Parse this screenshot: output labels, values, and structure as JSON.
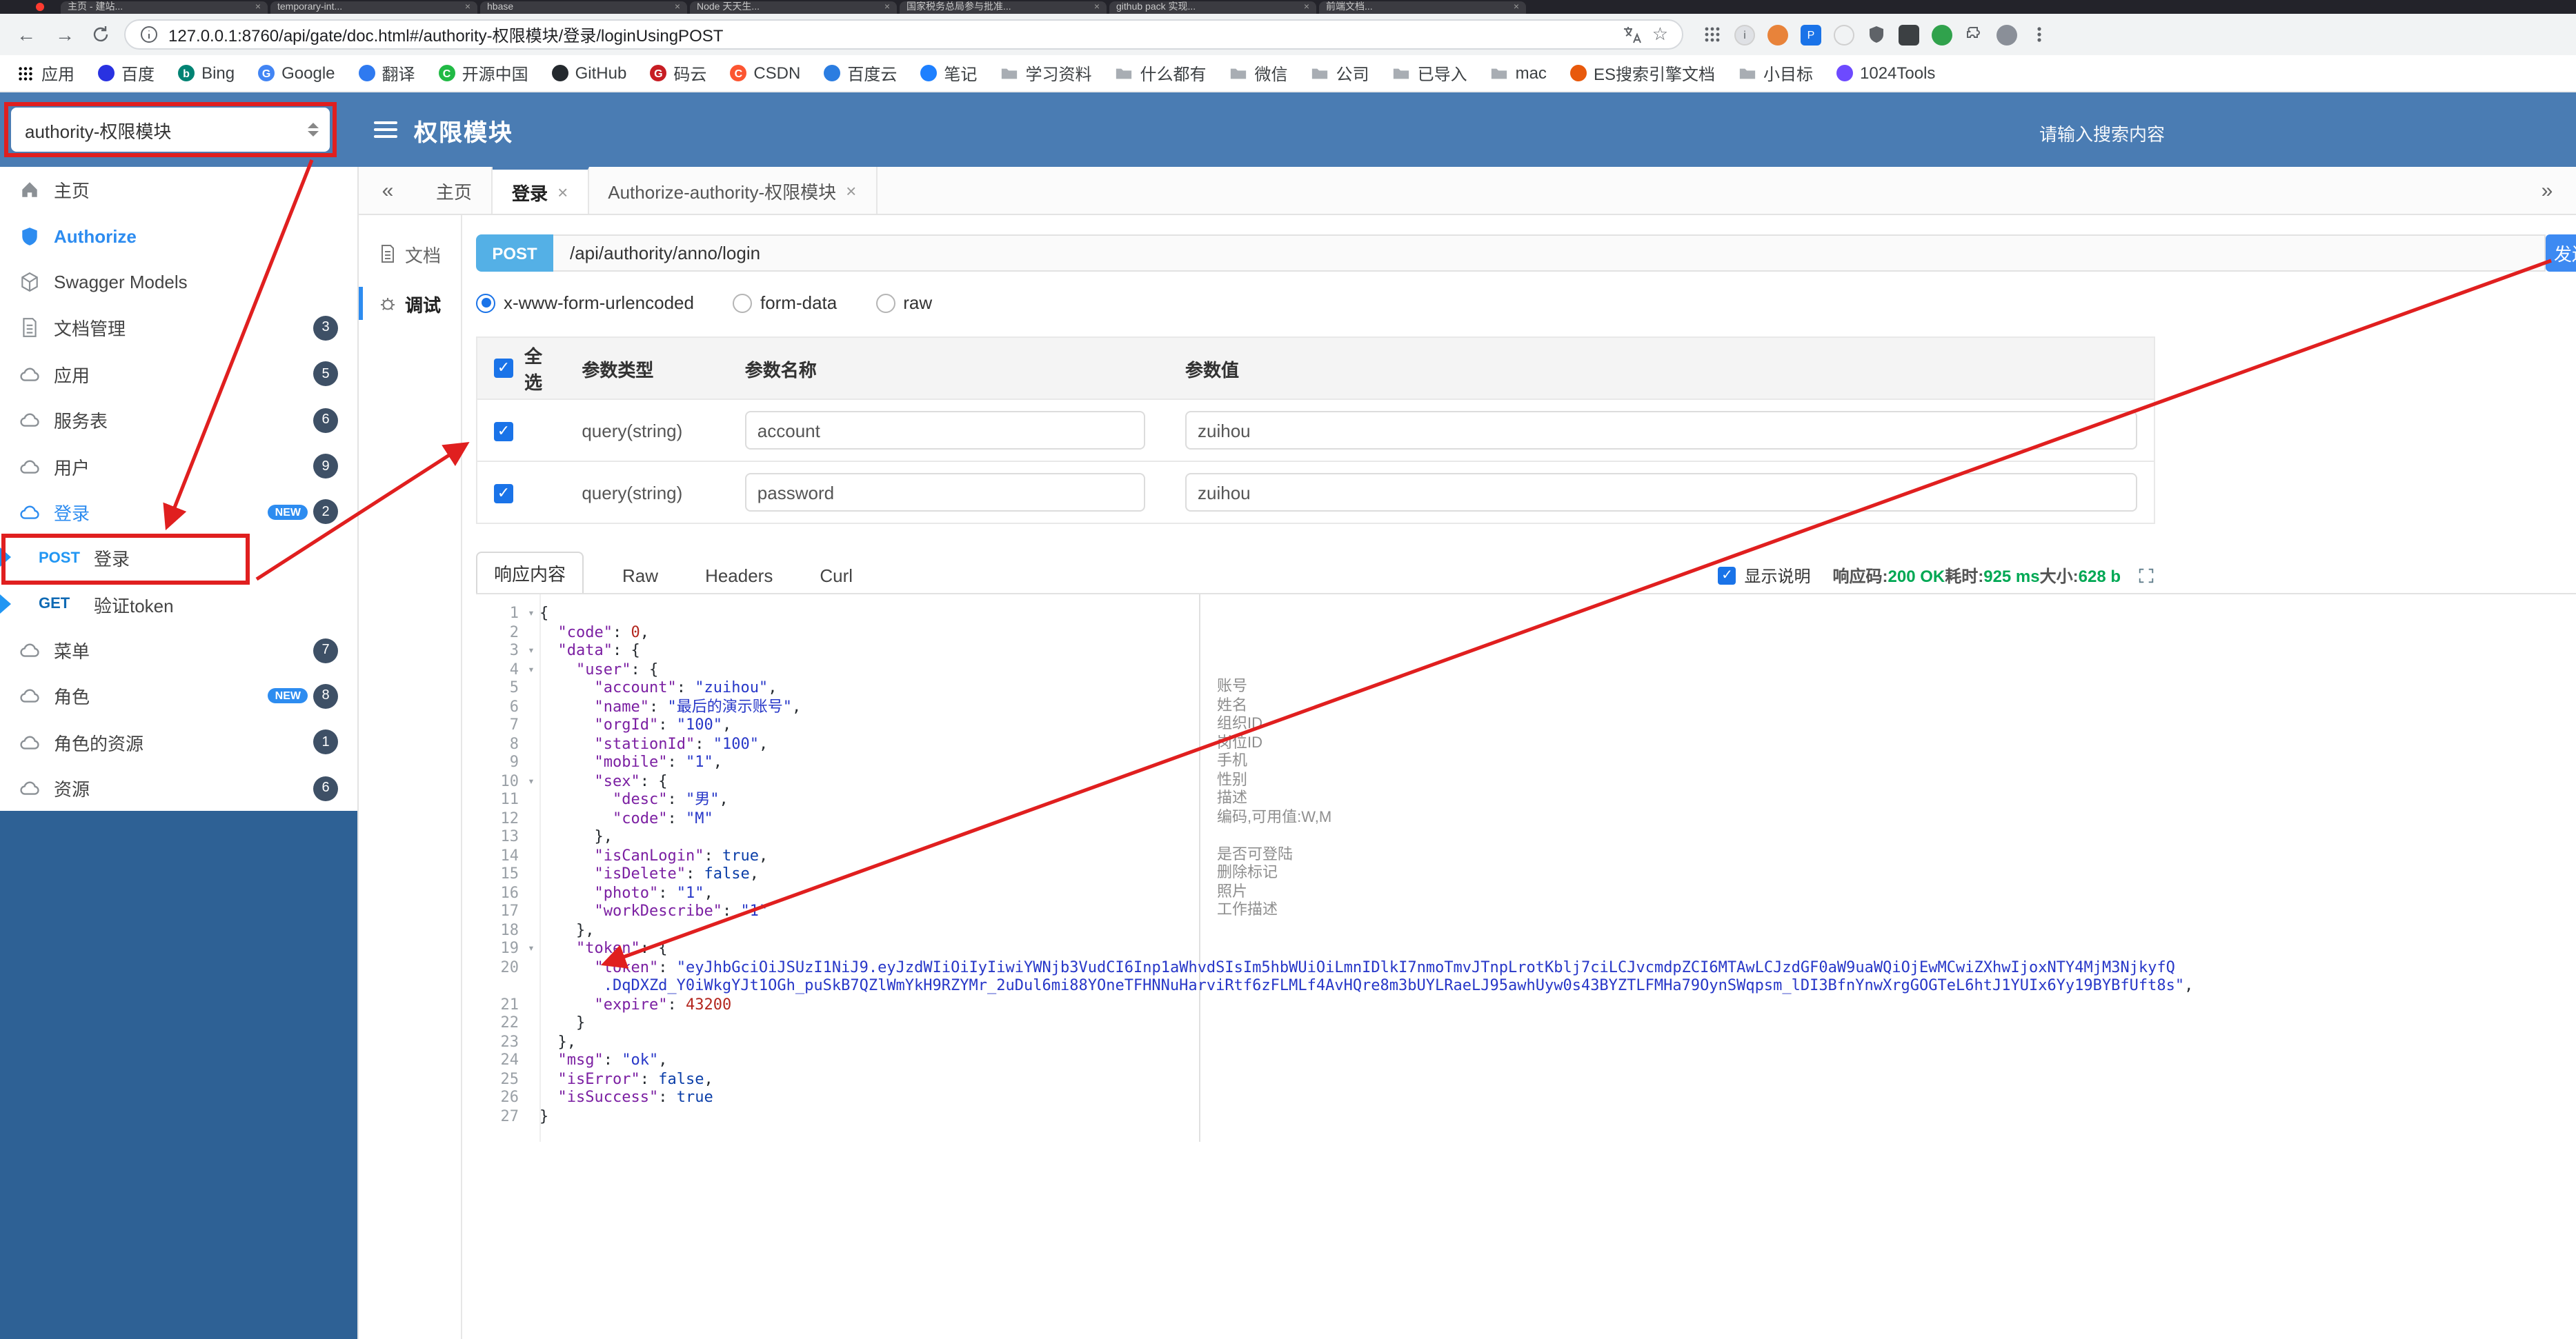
{
  "ui": {
    "back_glyph": "←",
    "forward_glyph": "→",
    "star_glyph": "☆",
    "check_glyph": "✓",
    "fold_glyph": "▾",
    "close_glyph": "×",
    "collapse_glyph": "«",
    "expand_glyph": "»"
  },
  "colors": {
    "header_blue": "#4a7cb3",
    "sidebar_blue": "#2e6195",
    "accent": "#2d8cf0",
    "post": "#2196f3",
    "get": "#0f6ab4",
    "send": "#3d8af2",
    "annotation_red": "#e01f1f",
    "success_green": "#00a854",
    "badge": "#3e5066"
  },
  "browser": {
    "tabs": [
      "主页 - 建站...",
      "temporary-int...",
      "hbase",
      "Node 天天生...",
      "国家税务总局参与批准...",
      "github pack 实现...",
      "前端文档..."
    ],
    "address": {
      "url": "127.0.0.1:8760/api/gate/doc.html#/authority-权限模块/登录/loginUsingPOST"
    },
    "extension_icons": [
      {
        "name": "extensions-grid-icon",
        "kind": "grid"
      },
      {
        "name": "info-badge-icon",
        "kind": "circle",
        "color": "#dfe1e5",
        "letter": "i"
      },
      {
        "name": "extension-orange-icon",
        "kind": "circle",
        "color": "#e8833a"
      },
      {
        "name": "extension-blue-square-icon",
        "kind": "sq",
        "color": "#1a73e8",
        "letter": "P"
      },
      {
        "name": "extension-white-icon",
        "kind": "circle",
        "color": "#f1f3f4"
      },
      {
        "name": "extension-shield-icon",
        "kind": "shield"
      },
      {
        "name": "extension-dark-square-icon",
        "kind": "sq",
        "color": "#3c4043"
      },
      {
        "name": "extension-green-icon",
        "kind": "circle",
        "color": "#30a24c"
      },
      {
        "name": "puzzle-icon",
        "kind": "puzzle"
      },
      {
        "name": "profile-avatar",
        "kind": "circle",
        "color": "#8a8f98"
      },
      {
        "name": "menu-kebab-icon",
        "kind": "kebab"
      }
    ],
    "bookmarks": [
      {
        "label": "应用",
        "icon": "grid"
      },
      {
        "label": "百度",
        "icon": "dot",
        "color": "#2932e1"
      },
      {
        "label": "Bing",
        "icon": "dot",
        "color": "#008373",
        "letter": "b"
      },
      {
        "label": "Google",
        "icon": "dot",
        "color": "#4285f4",
        "letter": "G"
      },
      {
        "label": "翻译",
        "icon": "dot",
        "color": "#2f7af0"
      },
      {
        "label": "开源中国",
        "icon": "dot",
        "color": "#21ba45",
        "letter": "C"
      },
      {
        "label": "GitHub",
        "icon": "dot",
        "color": "#24292e"
      },
      {
        "label": "码云",
        "icon": "dot",
        "color": "#c71d23",
        "letter": "G"
      },
      {
        "label": "CSDN",
        "icon": "dot",
        "color": "#fc5531",
        "letter": "C"
      },
      {
        "label": "百度云",
        "icon": "dot",
        "color": "#2b7de1"
      },
      {
        "label": "笔记",
        "icon": "dot",
        "color": "#1e80ff"
      },
      {
        "label": "学习资料",
        "icon": "folder"
      },
      {
        "label": "什么都有",
        "icon": "folder"
      },
      {
        "label": "微信",
        "icon": "folder"
      },
      {
        "label": "公司",
        "icon": "folder"
      },
      {
        "label": "已导入",
        "icon": "folder"
      },
      {
        "label": "mac",
        "icon": "folder"
      },
      {
        "label": "ES搜索引擎文档",
        "icon": "dot",
        "color": "#e8590c"
      },
      {
        "label": "小目标",
        "icon": "folder"
      },
      {
        "label": "1024Tools",
        "icon": "dot",
        "color": "#6d4aff"
      }
    ]
  },
  "header": {
    "module_select": "authority-权限模块",
    "title": "权限模块",
    "search_placeholder": "请输入搜索内容"
  },
  "sidebar": {
    "items": [
      {
        "id": "home",
        "label": "主页",
        "icon": "home"
      },
      {
        "id": "authorize",
        "label": "Authorize",
        "icon": "shield",
        "accent": true
      },
      {
        "id": "swagger-models",
        "label": "Swagger Models",
        "icon": "cube"
      },
      {
        "id": "doc-manage",
        "label": "文档管理",
        "icon": "file",
        "badge": "3"
      },
      {
        "id": "app",
        "label": "应用",
        "icon": "cloud",
        "badge": "5"
      },
      {
        "id": "service-table",
        "label": "服务表",
        "icon": "cloud",
        "badge": "6"
      },
      {
        "id": "user",
        "label": "用户",
        "icon": "cloud",
        "badge": "9"
      },
      {
        "id": "login",
        "label": "登录",
        "icon": "cloud",
        "badge": "2",
        "new": true,
        "active": true
      },
      {
        "id": "login-post",
        "label": "登录",
        "method": "POST",
        "child": true,
        "selected": true,
        "flag": true
      },
      {
        "id": "verify-token-get",
        "label": "验证token",
        "method": "GET",
        "child": true,
        "flag": true
      },
      {
        "id": "menu",
        "label": "菜单",
        "icon": "cloud",
        "badge": "7"
      },
      {
        "id": "role",
        "label": "角色",
        "icon": "cloud",
        "badge": "8",
        "new": true
      },
      {
        "id": "role-resource",
        "label": "角色的资源",
        "icon": "cloud",
        "badge": "1"
      },
      {
        "id": "resource",
        "label": "资源",
        "icon": "cloud",
        "badge": "6"
      }
    ]
  },
  "tabs": {
    "items": [
      {
        "label": "主页",
        "closable": false
      },
      {
        "label": "登录",
        "closable": true,
        "active": true
      },
      {
        "label": "Authorize-authority-权限模块",
        "closable": true
      }
    ]
  },
  "doc_nav": [
    {
      "id": "doc",
      "label": "文档",
      "icon": "file"
    },
    {
      "id": "debug",
      "label": "调试",
      "icon": "debug",
      "active": true
    }
  ],
  "request": {
    "method": "POST",
    "url": "/api/authority/anno/login",
    "send_label": "发送",
    "body_types": [
      {
        "label": "x-www-form-urlencoded",
        "selected": true
      },
      {
        "label": "form-data",
        "selected": false
      },
      {
        "label": "raw",
        "selected": false
      }
    ]
  },
  "params": {
    "headers": [
      "全选",
      "参数类型",
      "参数名称",
      "参数值"
    ],
    "rows": [
      {
        "checked": true,
        "type": "query(string)",
        "name": "account",
        "value": "zuihou"
      },
      {
        "checked": true,
        "type": "query(string)",
        "name": "password",
        "value": "zuihou"
      }
    ]
  },
  "response": {
    "tabs": [
      {
        "label": "响应内容",
        "active": true
      },
      {
        "label": "Raw",
        "active": false
      },
      {
        "label": "Headers",
        "active": false
      },
      {
        "label": "Curl",
        "active": false
      }
    ],
    "show_desc_label": "显示说明",
    "meta": [
      {
        "c": "plain",
        "t": "响应码:"
      },
      {
        "c": "ok",
        "t": "200 OK"
      },
      {
        "c": "plain",
        "t": "耗时:"
      },
      {
        "c": "ok",
        "t": "925 ms"
      },
      {
        "c": "plain",
        "t": "大小:"
      },
      {
        "c": "ok",
        "t": "628 b"
      }
    ],
    "code_lines": [
      {
        "n": "1",
        "f": true,
        "t": [
          [
            "p",
            "{"
          ]
        ]
      },
      {
        "n": "2",
        "t": [
          [
            "p",
            "  "
          ],
          [
            "k",
            "\"code\""
          ],
          [
            "p",
            ": "
          ],
          [
            "num",
            "0"
          ],
          [
            "p",
            ","
          ]
        ]
      },
      {
        "n": "3",
        "f": true,
        "t": [
          [
            "p",
            "  "
          ],
          [
            "k",
            "\"data\""
          ],
          [
            "p",
            ": {"
          ]
        ]
      },
      {
        "n": "4",
        "f": true,
        "t": [
          [
            "p",
            "    "
          ],
          [
            "k",
            "\"user\""
          ],
          [
            "p",
            ": {"
          ]
        ]
      },
      {
        "n": "5",
        "c": "账号",
        "t": [
          [
            "p",
            "      "
          ],
          [
            "k",
            "\"account\""
          ],
          [
            "p",
            ": "
          ],
          [
            "s",
            "\"zuihou\""
          ],
          [
            "p",
            ","
          ]
        ]
      },
      {
        "n": "6",
        "c": "姓名",
        "t": [
          [
            "p",
            "      "
          ],
          [
            "k",
            "\"name\""
          ],
          [
            "p",
            ": "
          ],
          [
            "s",
            "\"最后的演示账号\""
          ],
          [
            "p",
            ","
          ]
        ]
      },
      {
        "n": "7",
        "c": "组织ID",
        "t": [
          [
            "p",
            "      "
          ],
          [
            "k",
            "\"orgId\""
          ],
          [
            "p",
            ": "
          ],
          [
            "s",
            "\"100\""
          ],
          [
            "p",
            ","
          ]
        ]
      },
      {
        "n": "8",
        "c": "岗位ID",
        "t": [
          [
            "p",
            "      "
          ],
          [
            "k",
            "\"stationId\""
          ],
          [
            "p",
            ": "
          ],
          [
            "s",
            "\"100\""
          ],
          [
            "p",
            ","
          ]
        ]
      },
      {
        "n": "9",
        "c": "手机",
        "t": [
          [
            "p",
            "      "
          ],
          [
            "k",
            "\"mobile\""
          ],
          [
            "p",
            ": "
          ],
          [
            "s",
            "\"1\""
          ],
          [
            "p",
            ","
          ]
        ]
      },
      {
        "n": "10",
        "f": true,
        "c": "性别",
        "t": [
          [
            "p",
            "      "
          ],
          [
            "k",
            "\"sex\""
          ],
          [
            "p",
            ": {"
          ]
        ]
      },
      {
        "n": "11",
        "c": "描述",
        "t": [
          [
            "p",
            "        "
          ],
          [
            "k",
            "\"desc\""
          ],
          [
            "p",
            ": "
          ],
          [
            "s",
            "\"男\""
          ],
          [
            "p",
            ","
          ]
        ]
      },
      {
        "n": "12",
        "c": "编码,可用值:W,M",
        "t": [
          [
            "p",
            "        "
          ],
          [
            "k",
            "\"code\""
          ],
          [
            "p",
            ": "
          ],
          [
            "s",
            "\"M\""
          ]
        ]
      },
      {
        "n": "13",
        "t": [
          [
            "p",
            "      },"
          ]
        ]
      },
      {
        "n": "14",
        "c": "是否可登陆",
        "t": [
          [
            "p",
            "      "
          ],
          [
            "k",
            "\"isCanLogin\""
          ],
          [
            "p",
            ": "
          ],
          [
            "b",
            "true"
          ],
          [
            "p",
            ","
          ]
        ]
      },
      {
        "n": "15",
        "c": "删除标记",
        "t": [
          [
            "p",
            "      "
          ],
          [
            "k",
            "\"isDelete\""
          ],
          [
            "p",
            ": "
          ],
          [
            "b",
            "false"
          ],
          [
            "p",
            ","
          ]
        ]
      },
      {
        "n": "16",
        "c": "照片",
        "t": [
          [
            "p",
            "      "
          ],
          [
            "k",
            "\"photo\""
          ],
          [
            "p",
            ": "
          ],
          [
            "s",
            "\"1\""
          ],
          [
            "p",
            ","
          ]
        ]
      },
      {
        "n": "17",
        "c": "工作描述",
        "t": [
          [
            "p",
            "      "
          ],
          [
            "k",
            "\"workDescribe\""
          ],
          [
            "p",
            ": "
          ],
          [
            "s",
            "\"1\""
          ]
        ]
      },
      {
        "n": "18",
        "t": [
          [
            "p",
            "    },"
          ]
        ]
      },
      {
        "n": "19",
        "f": true,
        "t": [
          [
            "p",
            "    "
          ],
          [
            "k",
            "\"token\""
          ],
          [
            "p",
            ": {"
          ]
        ]
      },
      {
        "n": "20",
        "t": [
          [
            "p",
            "      "
          ],
          [
            "k",
            "\"token\""
          ],
          [
            "p",
            ": "
          ],
          [
            "s",
            "\"eyJhbGciOiJSUzI1NiJ9.eyJzdWIiOiIyIiwiYWNjb3VudCI6Inp1aWhvdSIsIm5hbWUiOiLmnIDlkI7nmoTmvJTnpLrotKblj7ciLCJvcmdpZCI6MTAwLCJzdGF0aW9uaWQiOjEwMCwiZXhwIjoxNTY4MjM3NjkyfQ"
          ]
        ]
      },
      {
        "n": "",
        "t": [
          [
            "s",
            "       .DqDXZd_Y0iWkgYJt1OGh_puSkB7QZlWmYkH9RZYMr_2uDul6mi88YOneTFHNNuHarviRtf6zFLMLf4AvHQre8m3bUYLRaeLJ95awhUyw0s43BYZTLFMHa79OynSWqpsm_lDI3BfnYnwXrgGOGTeL6htJ1YUIx6Yy19BYBfUft8s\""
          ],
          [
            "p",
            ","
          ]
        ]
      },
      {
        "n": "21",
        "t": [
          [
            "p",
            "      "
          ],
          [
            "k",
            "\"expire\""
          ],
          [
            "p",
            ": "
          ],
          [
            "num",
            "43200"
          ]
        ]
      },
      {
        "n": "22",
        "t": [
          [
            "p",
            "    }"
          ]
        ]
      },
      {
        "n": "23",
        "t": [
          [
            "p",
            "  },"
          ]
        ]
      },
      {
        "n": "24",
        "t": [
          [
            "p",
            "  "
          ],
          [
            "k",
            "\"msg\""
          ],
          [
            "p",
            ": "
          ],
          [
            "s",
            "\"ok\""
          ],
          [
            "p",
            ","
          ]
        ]
      },
      {
        "n": "25",
        "t": [
          [
            "p",
            "  "
          ],
          [
            "k",
            "\"isError\""
          ],
          [
            "p",
            ": "
          ],
          [
            "b",
            "false"
          ],
          [
            "p",
            ","
          ]
        ]
      },
      {
        "n": "26",
        "t": [
          [
            "p",
            "  "
          ],
          [
            "k",
            "\"isSuccess\""
          ],
          [
            "p",
            ": "
          ],
          [
            "b",
            "true"
          ]
        ]
      },
      {
        "n": "27",
        "t": [
          [
            "p",
            "}"
          ]
        ]
      }
    ]
  }
}
